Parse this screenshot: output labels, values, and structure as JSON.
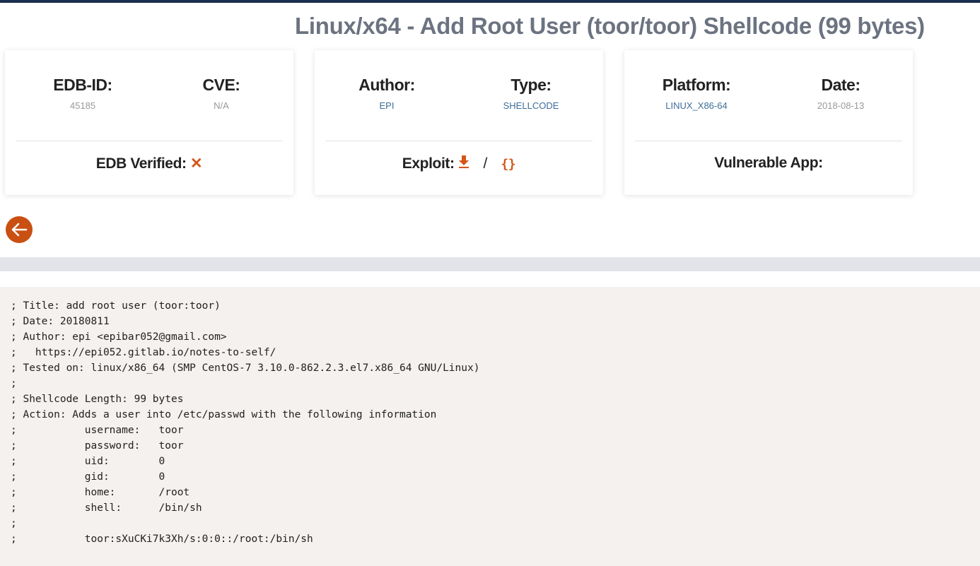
{
  "title": "Linux/x64 - Add Root User (toor/toor) Shellcode (99 bytes)",
  "cards": [
    {
      "fields": [
        {
          "label": "EDB-ID:",
          "value": "45185"
        },
        {
          "label": "CVE:",
          "value": "N/A"
        }
      ],
      "footer_label": "EDB Verified:"
    },
    {
      "fields": [
        {
          "label": "Author:",
          "value": "EPI"
        },
        {
          "label": "Type:",
          "value": "SHELLCODE"
        }
      ],
      "footer_label": "Exploit:",
      "separator": "/"
    },
    {
      "fields": [
        {
          "label": "Platform:",
          "value": "LINUX_X86-64"
        },
        {
          "label": "Date:",
          "value": "2018-08-13"
        }
      ],
      "footer_label": "Vulnerable App:"
    }
  ],
  "icons": {
    "verified": "close-icon",
    "download": "download-icon",
    "raw": "code-braces-icon",
    "back": "arrow-left-icon"
  },
  "colors": {
    "accent": "#c94f12",
    "code_bg": "#f4f1ee"
  },
  "code": "; Title: add root user (toor:toor)\n; Date: 20180811\n; Author: epi <epibar052@gmail.com>\n;   https://epi052.gitlab.io/notes-to-self/\n; Tested on: linux/x86_64 (SMP CentOS-7 3.10.0-862.2.3.el7.x86_64 GNU/Linux)\n;\n; Shellcode Length: 99 bytes\n; Action: Adds a user into /etc/passwd with the following information\n;           username:   toor\n;           password:   toor\n;           uid:        0\n;           gid:        0\n;           home:       /root\n;           shell:      /bin/sh\n;\n;           toor:sXuCKi7k3Xh/s:0:0::/root:/bin/sh"
}
